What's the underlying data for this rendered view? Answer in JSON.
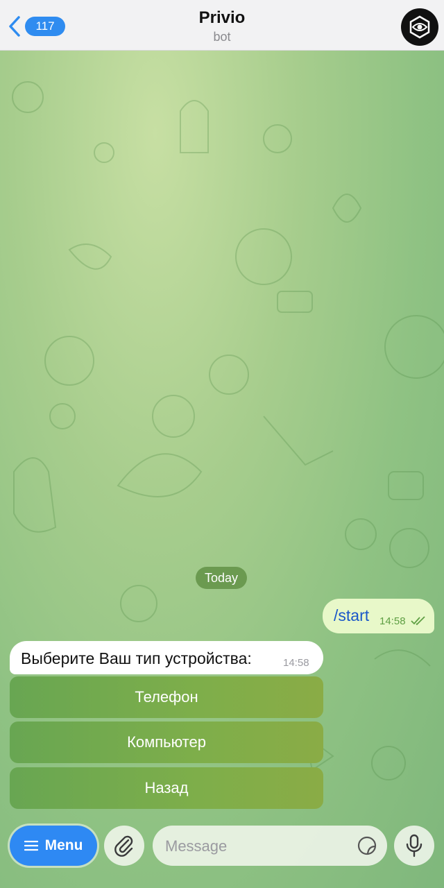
{
  "header": {
    "back_count": "117",
    "title": "Privio",
    "subtitle": "bot"
  },
  "chat": {
    "date_label": "Today",
    "outgoing": {
      "text": "/start",
      "time": "14:58",
      "status": "read"
    },
    "incoming": {
      "text": "Выберите Ваш тип устройства:",
      "time": "14:58"
    },
    "keyboard": [
      {
        "label": "Телефон"
      },
      {
        "label": "Компьютер"
      },
      {
        "label": "Назад"
      }
    ]
  },
  "composer": {
    "menu_label": "Menu",
    "placeholder": "Message"
  },
  "colors": {
    "accent": "#2e89f3",
    "outgoing_bubble": "#e8f8c9",
    "keyboard_button": "#7eae4a"
  }
}
